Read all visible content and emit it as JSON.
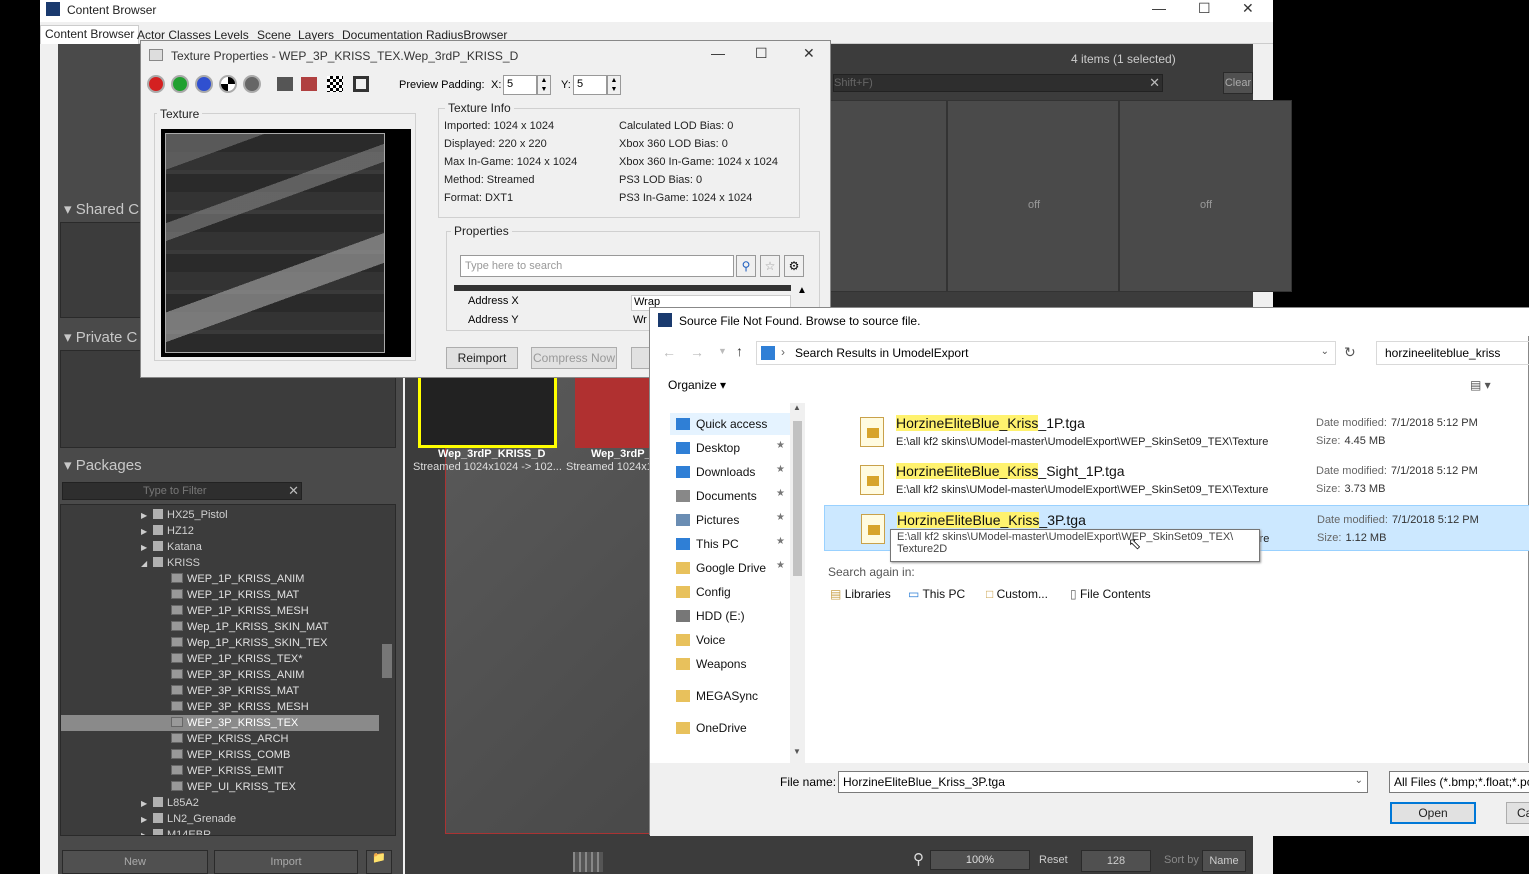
{
  "content_browser": {
    "title": "Content Browser",
    "tabs": [
      "Content Browser",
      "Actor Classes",
      "Levels",
      "Scene",
      "Layers",
      "Documentation",
      "RadiusBrowser"
    ],
    "items_count": "4 items (1 selected)",
    "search_hint": "Shift+F)",
    "clear_label": "Clear",
    "panels": {
      "shared": "Shared C",
      "private": "Private C",
      "packages": "Packages"
    },
    "filter_placeholder": "Type to Filter",
    "tree": [
      {
        "label": "HX25_Pistol",
        "kind": "folder",
        "indent": 0
      },
      {
        "label": "HZ12",
        "kind": "folder",
        "indent": 0
      },
      {
        "label": "Katana",
        "kind": "folder",
        "indent": 0
      },
      {
        "label": "KRISS",
        "kind": "folder",
        "indent": 0
      },
      {
        "label": "WEP_1P_KRISS_ANIM",
        "kind": "package",
        "indent": 1
      },
      {
        "label": "WEP_1P_KRISS_MAT",
        "kind": "package",
        "indent": 1
      },
      {
        "label": "WEP_1P_KRISS_MESH",
        "kind": "package",
        "indent": 1
      },
      {
        "label": "Wep_1P_KRISS_SKIN_MAT",
        "kind": "package",
        "indent": 1
      },
      {
        "label": "Wep_1P_KRISS_SKIN_TEX",
        "kind": "package",
        "indent": 1
      },
      {
        "label": "WEP_1P_KRISS_TEX*",
        "kind": "package",
        "indent": 1
      },
      {
        "label": "WEP_3P_KRISS_ANIM",
        "kind": "package",
        "indent": 1
      },
      {
        "label": "WEP_3P_KRISS_MAT",
        "kind": "package",
        "indent": 1
      },
      {
        "label": "WEP_3P_KRISS_MESH",
        "kind": "package",
        "indent": 1
      },
      {
        "label": "WEP_3P_KRISS_TEX",
        "kind": "package",
        "indent": 1
      },
      {
        "label": "WEP_KRISS_ARCH",
        "kind": "package",
        "indent": 1
      },
      {
        "label": "WEP_KRISS_COMB",
        "kind": "package",
        "indent": 1
      },
      {
        "label": "WEP_KRISS_EMIT",
        "kind": "package",
        "indent": 1
      },
      {
        "label": "WEP_UI_KRISS_TEX",
        "kind": "package",
        "indent": 1
      },
      {
        "label": "L85A2",
        "kind": "folder",
        "indent": 0
      },
      {
        "label": "LN2_Grenade",
        "kind": "folder",
        "indent": 0
      },
      {
        "label": "M14EBR",
        "kind": "folder",
        "indent": 0
      }
    ],
    "bottom": {
      "new": "New",
      "import": "Import",
      "zoom": "100%",
      "reset": "Reset",
      "size": "128",
      "sort_by": "Sort by",
      "sort_value": "Name"
    },
    "grid_cells": [
      "off",
      "off"
    ],
    "thumbs": [
      {
        "name": "Wep_3rdP_KRISS_D",
        "sub": "Streamed 1024x1024 -> 102..."
      },
      {
        "name": "Wep_3rdP_I",
        "sub": "Streamed 1024x1"
      }
    ]
  },
  "texture_props": {
    "title": "Texture Properties - WEP_3P_KRISS_TEX.Wep_3rdP_KRISS_D",
    "preview_padding": "Preview Padding:",
    "x_label": "X:",
    "x_value": "5",
    "y_label": "Y:",
    "y_value": "5",
    "texture_label": "Texture",
    "info_label": "Texture Info",
    "info_left": [
      "Imported: 1024 x 1024",
      "Displayed: 220 x 220",
      "Max In-Game: 1024 x 1024",
      "Method: Streamed",
      "Format: DXT1"
    ],
    "info_right": [
      "Calculated LOD Bias: 0",
      "Xbox 360 LOD Bias: 0",
      "Xbox 360 In-Game: 1024 x 1024",
      "PS3 LOD Bias: 0",
      "PS3 In-Game: 1024 x 1024"
    ],
    "properties_label": "Properties",
    "search_placeholder": "Type here to search",
    "props": [
      {
        "name": "Address X",
        "value": "Wrap"
      },
      {
        "name": "Address Y",
        "value": "Wr"
      }
    ],
    "reimport": "Reimport",
    "compress_now": "Compress Now"
  },
  "file_dialog": {
    "title": "Source File Not Found.  Browse to source file.",
    "breadcrumb": "Search Results in UmodelExport",
    "search_value": "horzineeliteblue_kriss",
    "organize": "Organize",
    "nav": [
      {
        "label": "Quick access",
        "icon": "star-icon",
        "pinned": false
      },
      {
        "label": "Desktop",
        "icon": "desktop-icon",
        "pinned": true
      },
      {
        "label": "Downloads",
        "icon": "download-icon",
        "pinned": true
      },
      {
        "label": "Documents",
        "icon": "documents-icon",
        "pinned": true
      },
      {
        "label": "Pictures",
        "icon": "pictures-icon",
        "pinned": true
      },
      {
        "label": "This PC",
        "icon": "computer-icon",
        "pinned": true
      },
      {
        "label": "Google Drive",
        "icon": "folder-icon",
        "pinned": true
      },
      {
        "label": "Config",
        "icon": "folder-icon",
        "pinned": false
      },
      {
        "label": "HDD (E:)",
        "icon": "drive-icon",
        "pinned": false
      },
      {
        "label": "Voice",
        "icon": "folder-icon",
        "pinned": false
      },
      {
        "label": "Weapons",
        "icon": "folder-icon",
        "pinned": false
      },
      {
        "label": "MEGASync",
        "icon": "folder-icon",
        "pinned": false
      },
      {
        "label": "OneDrive",
        "icon": "folder-icon",
        "pinned": false
      }
    ],
    "files": [
      {
        "highlight": "HorzineEliteBlue_Kriss",
        "rest": "_1P.tga",
        "path": "E:\\all kf2 skins\\UModel-master\\UmodelExport\\WEP_SkinSet09_TEX\\Texture",
        "date_label": "Date modified:",
        "date": "7/1/2018 5:12 PM",
        "size_label": "Size:",
        "size": "4.45 MB"
      },
      {
        "highlight": "HorzineEliteBlue_Kriss",
        "rest": "_Sight_1P.tga",
        "path": "E:\\all kf2 skins\\UModel-master\\UmodelExport\\WEP_SkinSet09_TEX\\Texture",
        "date_label": "Date modified:",
        "date": "7/1/2018 5:12 PM",
        "size_label": "Size:",
        "size": "3.73 MB"
      },
      {
        "highlight": "HorzineEliteBlue_Kriss",
        "rest": "_3P.tga",
        "path": "E:\\all kf2 skins\\UModel-master\\UmodelExport\\WEP_SkinSet09_TEX\\Texture",
        "date_label": "Date modified:",
        "date": "7/1/2018 5:12 PM",
        "size_label": "Size:",
        "size": "1.12 MB"
      }
    ],
    "tooltip_line1": "E:\\all kf2 skins\\UModel-master\\UmodelExport\\WEP_SkinSet09_TEX\\",
    "tooltip_line2": "Texture2D",
    "search_again": "Search again in:",
    "search_links": [
      "Libraries",
      "This PC",
      "Custom...",
      "File Contents"
    ],
    "file_name_label": "File name:",
    "file_name_value": "HorzineEliteBlue_Kriss_3P.tga",
    "filter_value": "All Files (*.bmp;*.float;*.pc",
    "open": "Open",
    "cancel": "Ca"
  },
  "colors": {
    "accent": "#0078d7",
    "highlight": "#fff26e",
    "selected_row": "#cce8ff",
    "selected_thumb": "#ffff00"
  }
}
